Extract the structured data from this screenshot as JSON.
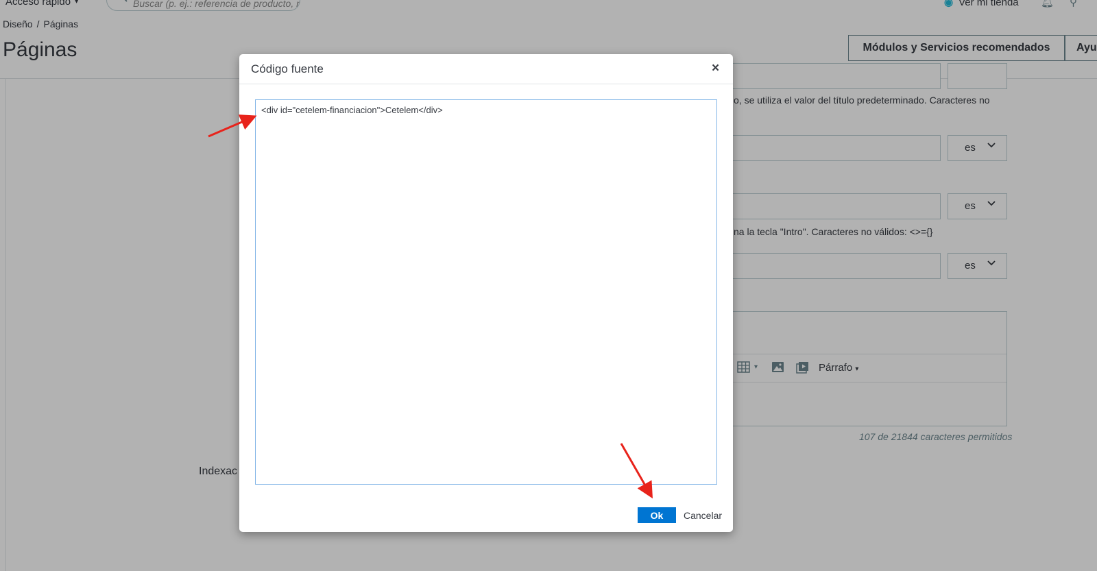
{
  "topbar": {
    "quick_access": "Acceso rápido",
    "search_placeholder": "Buscar (p. ej.: referencia de producto, nombre de cliente…)",
    "view_store": "Ver mi tienda"
  },
  "breadcrumb": [
    "Diseño",
    "Páginas"
  ],
  "breadcrumb_sep": "/",
  "page_title": "Páginas",
  "header_buttons": {
    "modules": "Módulos y Servicios recomendados",
    "help": "Ayuda"
  },
  "form": {
    "lang": "es",
    "help_title": "o, se utiliza el valor del título predeterminado. Caracteres no",
    "help_keywords": "na la tecla \"Intro\". Caracteres no válidos: <>={}",
    "toolbar_paragraph": "Párrafo",
    "char_count": "107 de 21844 caracteres permitidos",
    "indexation_label": "Indexac"
  },
  "modal": {
    "title": "Código fuente",
    "code": "<div id=\"cetelem-financiacion\">Cetelem</div>",
    "ok_label": "Ok",
    "cancel_label": "Cancelar"
  },
  "colors": {
    "primary": "#0075d2",
    "annotation_arrow": "#e8231b"
  },
  "icons": {
    "search": "search-icon",
    "close": "close-icon",
    "bell": "bell-icon",
    "user": "user-icon",
    "chevron": "chevron-down-icon"
  }
}
